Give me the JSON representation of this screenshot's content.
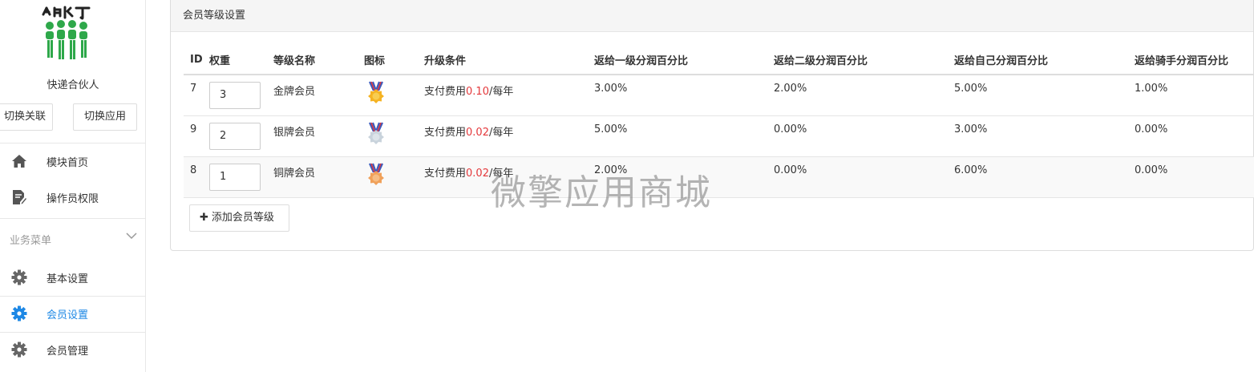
{
  "sidebar": {
    "app_name": "快递合伙人",
    "switch_link_label": "切换关联",
    "switch_app_label": "切换应用",
    "top_items": [
      {
        "label": "模块首页",
        "icon": "home-icon"
      },
      {
        "label": "操作员权限",
        "icon": "document-edit-icon"
      }
    ],
    "section_title": "业务菜单",
    "section_items": [
      {
        "label": "基本设置",
        "icon": "gear-icon",
        "active": false
      },
      {
        "label": "会员设置",
        "icon": "gear-icon",
        "active": true
      },
      {
        "label": "会员管理",
        "icon": "gear-icon",
        "active": false
      }
    ]
  },
  "panel": {
    "title": "会员等级设置",
    "columns": [
      "ID",
      "权重",
      "等级名称",
      "图标",
      "升级条件",
      "返给一级分润百分比",
      "返给二级分润百分比",
      "返给自己分润百分比",
      "返给骑手分润百分比"
    ],
    "rows": [
      {
        "id": "7",
        "weight": "3",
        "name": "金牌会员",
        "medal": "gold-medal-icon",
        "cond_prefix": "支付费用",
        "cond_amount": "0.10",
        "cond_suffix": "/每年",
        "p1": "3.00%",
        "p2": "2.00%",
        "p3": "5.00%",
        "p4": "1.00%"
      },
      {
        "id": "9",
        "weight": "2",
        "name": "银牌会员",
        "medal": "silver-medal-icon",
        "cond_prefix": "支付费用",
        "cond_amount": "0.02",
        "cond_suffix": "/每年",
        "p1": "5.00%",
        "p2": "0.00%",
        "p3": "3.00%",
        "p4": "0.00%"
      },
      {
        "id": "8",
        "weight": "1",
        "name": "铜牌会员",
        "medal": "bronze-medal-icon",
        "cond_prefix": "支付费用",
        "cond_amount": "0.02",
        "cond_suffix": "/每年",
        "p1": "2.00%",
        "p2": "0.00%",
        "p3": "6.00%",
        "p4": "0.00%"
      }
    ],
    "add_button_label": "添加会员等级"
  },
  "watermark": "微擎应用商城",
  "colors": {
    "accent": "#1e88e5",
    "price": "#e4393c",
    "logo_green": "#2ea84a",
    "gold": "#f5b323",
    "silver": "#c9d3dc",
    "bronze": "#f0a15a"
  }
}
